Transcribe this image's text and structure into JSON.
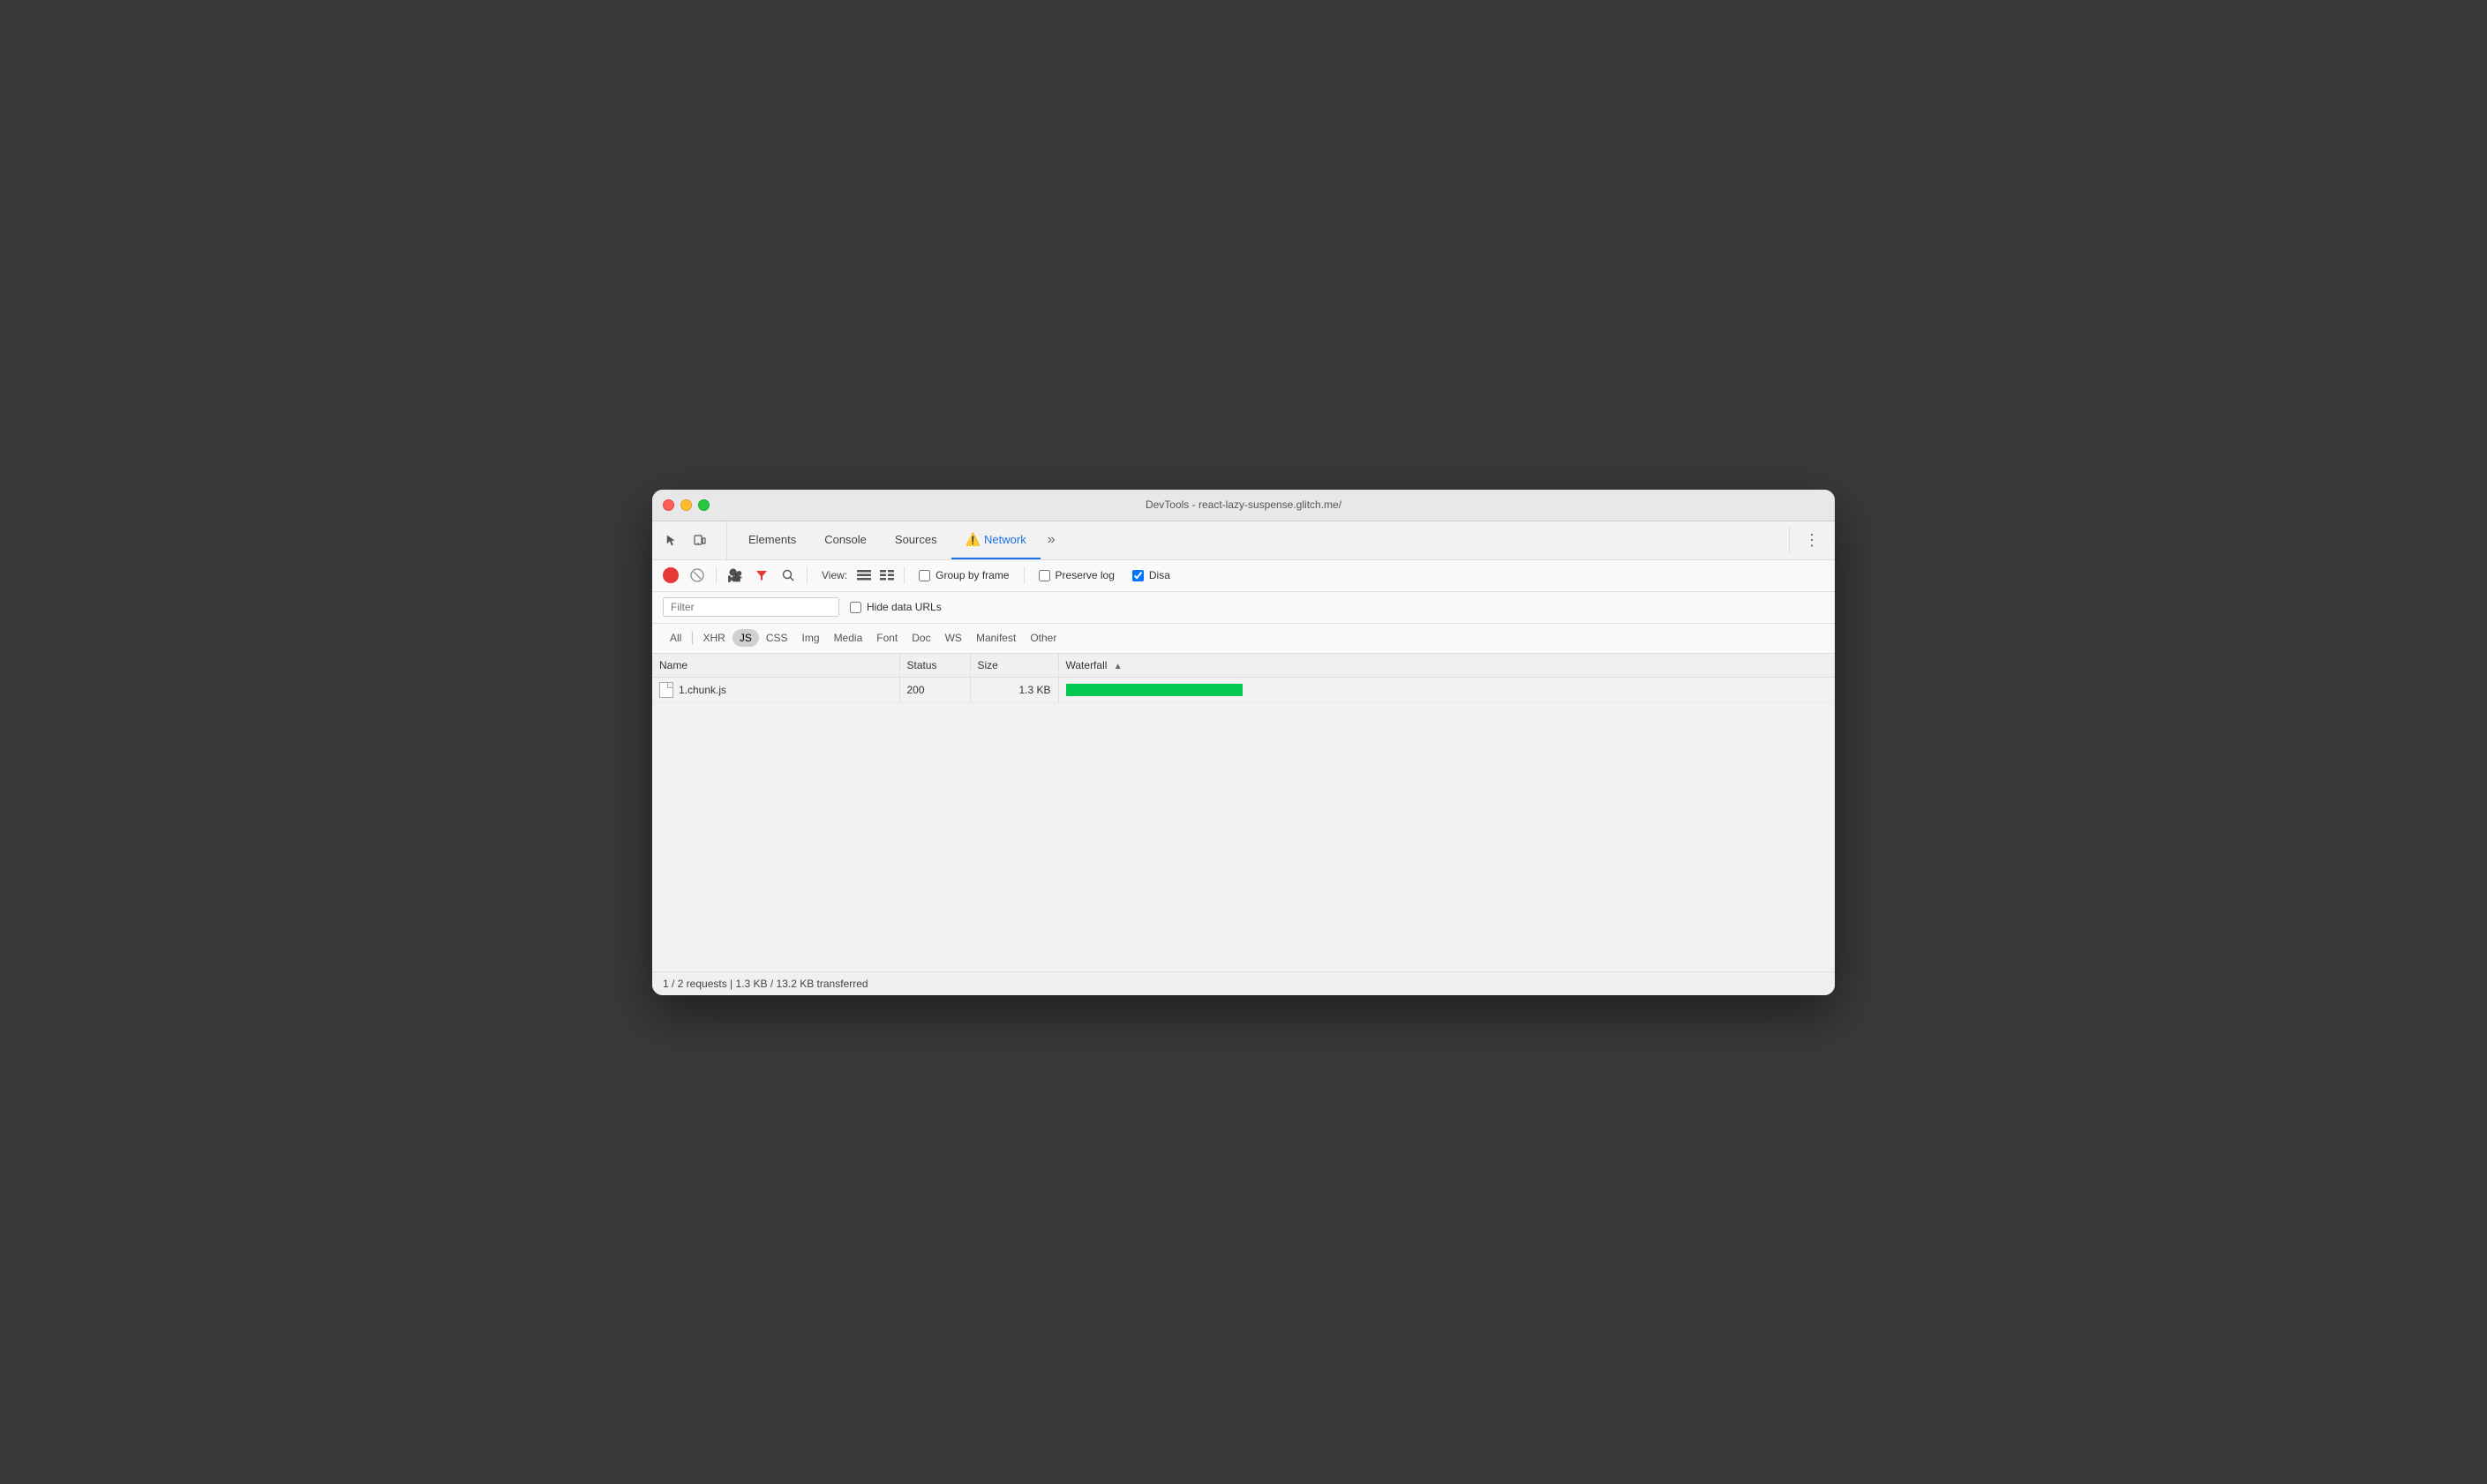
{
  "window": {
    "title": "DevTools - react-lazy-suspense.glitch.me/"
  },
  "traffic_lights": {
    "red": "close",
    "yellow": "minimize",
    "green": "maximize"
  },
  "tabs": [
    {
      "id": "elements",
      "label": "Elements",
      "active": false
    },
    {
      "id": "console",
      "label": "Console",
      "active": false
    },
    {
      "id": "sources",
      "label": "Sources",
      "active": false
    },
    {
      "id": "network",
      "label": "Network",
      "active": true,
      "warning": true
    },
    {
      "id": "more",
      "label": "»",
      "active": false
    }
  ],
  "toolbar": {
    "record_title": "Record",
    "stop_title": "Stop recording",
    "camera_title": "Capture screenshot",
    "filter_title": "Filter",
    "search_title": "Search",
    "view_label": "View:",
    "group_by_frame": {
      "label": "Group by frame",
      "checked": false
    },
    "preserve_log": {
      "label": "Preserve log",
      "checked": false
    },
    "disable_cache": {
      "label": "Disa",
      "checked": true
    }
  },
  "filter_bar": {
    "placeholder": "Filter",
    "hide_data_urls": {
      "label": "Hide data URLs",
      "checked": false
    }
  },
  "type_filters": [
    {
      "id": "all",
      "label": "All",
      "active": false
    },
    {
      "id": "xhr",
      "label": "XHR",
      "active": false
    },
    {
      "id": "js",
      "label": "JS",
      "active": true
    },
    {
      "id": "css",
      "label": "CSS",
      "active": false
    },
    {
      "id": "img",
      "label": "Img",
      "active": false
    },
    {
      "id": "media",
      "label": "Media",
      "active": false
    },
    {
      "id": "font",
      "label": "Font",
      "active": false
    },
    {
      "id": "doc",
      "label": "Doc",
      "active": false
    },
    {
      "id": "ws",
      "label": "WS",
      "active": false
    },
    {
      "id": "manifest",
      "label": "Manifest",
      "active": false
    },
    {
      "id": "other",
      "label": "Other",
      "active": false
    }
  ],
  "table": {
    "columns": [
      {
        "id": "name",
        "label": "Name"
      },
      {
        "id": "status",
        "label": "Status"
      },
      {
        "id": "size",
        "label": "Size"
      },
      {
        "id": "waterfall",
        "label": "Waterfall"
      }
    ],
    "rows": [
      {
        "name": "1.chunk.js",
        "status": "200",
        "size": "1.3 KB",
        "has_waterfall": true
      }
    ]
  },
  "status_bar": {
    "text": "1 / 2 requests | 1.3 KB / 13.2 KB transferred"
  },
  "colors": {
    "active_tab": "#1a73e8",
    "record_red": "#e53935",
    "waterfall_green": "#00c853",
    "warning_yellow": "#f5a623"
  }
}
